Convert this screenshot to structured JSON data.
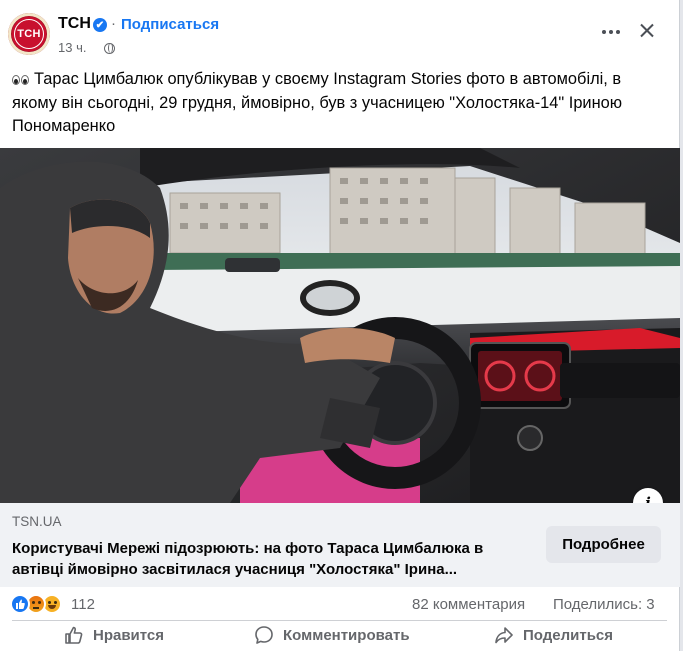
{
  "header": {
    "avatar_label": "ТСН",
    "page_name": "ТСН",
    "verified_mark": "✔",
    "separator": "·",
    "subscribe_label": "Подписаться",
    "time": "13 ч.",
    "privacy_icon": "globe-icon",
    "more_icon": "more-horizontal-icon",
    "close_icon": "close-icon"
  },
  "post": {
    "emoji_icon": "eyes-emoji-icon",
    "text": "Тарас Цимбалюк опублікував у своєму Instagram Stories фото в автомобілі, в якому він сьогодні, 29 грудня, ймовірно, був з учасницею \"Холостяка-14\" Іриною Пономаренко"
  },
  "media": {
    "description_icon": "photo-car-selfie",
    "info_label": "i"
  },
  "link_preview": {
    "domain": "TSN.UA",
    "title": "Користувачі Мережі підозрюють: на фото Тараса Цимбалюка в автівці ймовірно засвітилася учасниця \"Холостяка\" Ірина...",
    "button_label": "Подробнее"
  },
  "stats": {
    "reaction_icons": [
      "like-icon",
      "angry-icon",
      "haha-icon"
    ],
    "reactions_count": "112",
    "comments": "82 комментария",
    "shares": "Поделились: 3"
  },
  "actions": {
    "like_label": "Нравится",
    "comment_label": "Комментировать",
    "share_label": "Поделиться"
  },
  "colors": {
    "accent": "#1877f2",
    "secondary_text": "#65676b",
    "preview_bg": "#f0f2f5",
    "brand_red": "#c8102e"
  }
}
